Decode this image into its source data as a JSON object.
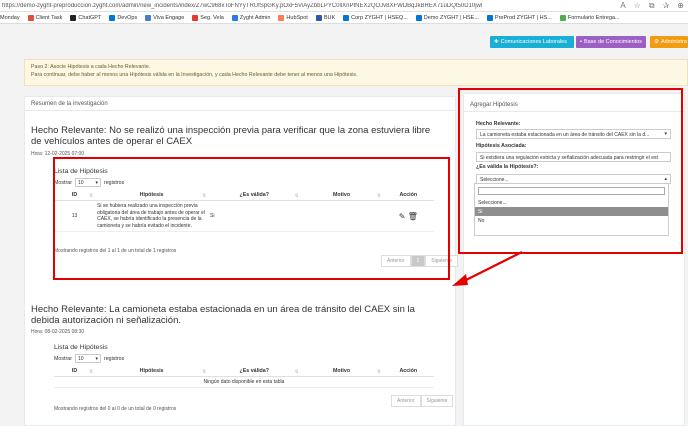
{
  "browser": {
    "url": "https://demo-zyght-preproduccion.zyght.com/admin/new_incidents/index/Z7wC968xToFNYyTRUfSpGKy.pOxF5ViAyZbbLPYC0llXnPtNEX2QOJv8XFWDBqJkBREX71uDQt50D10jwNNA~",
    "bookmarks": [
      "Monday",
      "Client Task",
      "ChatGPT",
      "DevOps",
      "Viva Engage",
      "Seg. Vela",
      "Zyght Admin",
      "HubSpot",
      "BUK",
      "Corp ZYGHT | HSEQ...",
      "Demo ZYGHT | HSE...",
      "PreProd ZYGHT | HS...",
      "Formulario Entrega..."
    ],
    "bookmark_colors": [
      "#f0a11f",
      "#e74c3c",
      "#222222",
      "#0078d4",
      "#4a7bd0",
      "#e53935",
      "#2c7be5",
      "#ff7a59",
      "#2b58a8",
      "#0078d4",
      "#0078d4",
      "#0078d4",
      "#4caf50"
    ]
  },
  "topbar": {
    "btn_comunicaciones": "Comunicaciones Laborales",
    "btn_base": "Base de Conocimientos",
    "btn_admin": "Administra"
  },
  "alert": {
    "line1": "Paso 2: Asocie Hipótesis a cada Hecho Relevante.",
    "line2": "Para continuar, debe haber al menos una Hipótesis válida en la Investigación, y cada Hecho Relevante debe tener al menos una Hipótesis."
  },
  "left_panel": {
    "title": "Resumen de la investigación",
    "hecho1": {
      "title": "Hecho Relevante: No se realizó una inspección previa para verificar que la zona estuviera libre de vehículos antes de operar el CAEX",
      "hora": "Hora: 12-02-2025 07:00",
      "lista_title": "Lista de Hipótesis",
      "mostrar": "Mostrar",
      "page_size": "10",
      "registros": "registros",
      "columns": [
        "ID",
        "Hipótesis",
        "¿Es válida?",
        "Motivo",
        "Acción"
      ],
      "row": {
        "id": "13",
        "hipotesis": "Si se hubiera realizado una inspección previa obligatoria del área de trabajo antes de operar el CAEX, se habría identificado la presencia de la camioneta y se habría evitado el incidente.",
        "valida": "Si",
        "motivo": ""
      },
      "footer": "Mostrando registros del 1 al 1 de un total de 1 registros",
      "prev": "Anterior",
      "page": "1",
      "next": "Siguiente"
    },
    "hecho2": {
      "title": "Hecho Relevante: La camioneta estaba estacionada en un área de tránsito del CAEX sin la debida autorización ni señalización.",
      "hora": "Hora: 08-02-2025 08:30",
      "lista_title": "Lista de Hipótesis",
      "mostrar": "Mostrar",
      "page_size": "10",
      "registros": "registros",
      "columns": [
        "ID",
        "Hipótesis",
        "¿Es válida?",
        "Motivo",
        "Acción"
      ],
      "empty": "Ningún dato disponible en esta tabla",
      "footer": "Mostrando registros del 0 al 0 de un total de 0 registros",
      "prev": "Anterior",
      "next": "Siguiente"
    }
  },
  "right_panel": {
    "title": "Agregar Hipótesis",
    "hecho_label": "Hecho Relevante:",
    "hecho_value": "La camioneta estaba estacionada en un área de tránsito del CAEX sin la d...",
    "hipotesis_label": "Hipótesis Asociada:",
    "hipotesis_value": "Si existiera una regulación estricta y señalización adecuada para restringir el est",
    "valida_label": "¿Es válida la Hipótesis?:",
    "valida_value": "Seleccione...",
    "options": [
      "Seleccione...",
      "Si",
      "No"
    ]
  },
  "colors": {
    "btn_comunicaciones": "#1ab0d6",
    "btn_base": "#9c5fc4",
    "btn_admin": "#f39c12",
    "annotation": "#e30000"
  }
}
